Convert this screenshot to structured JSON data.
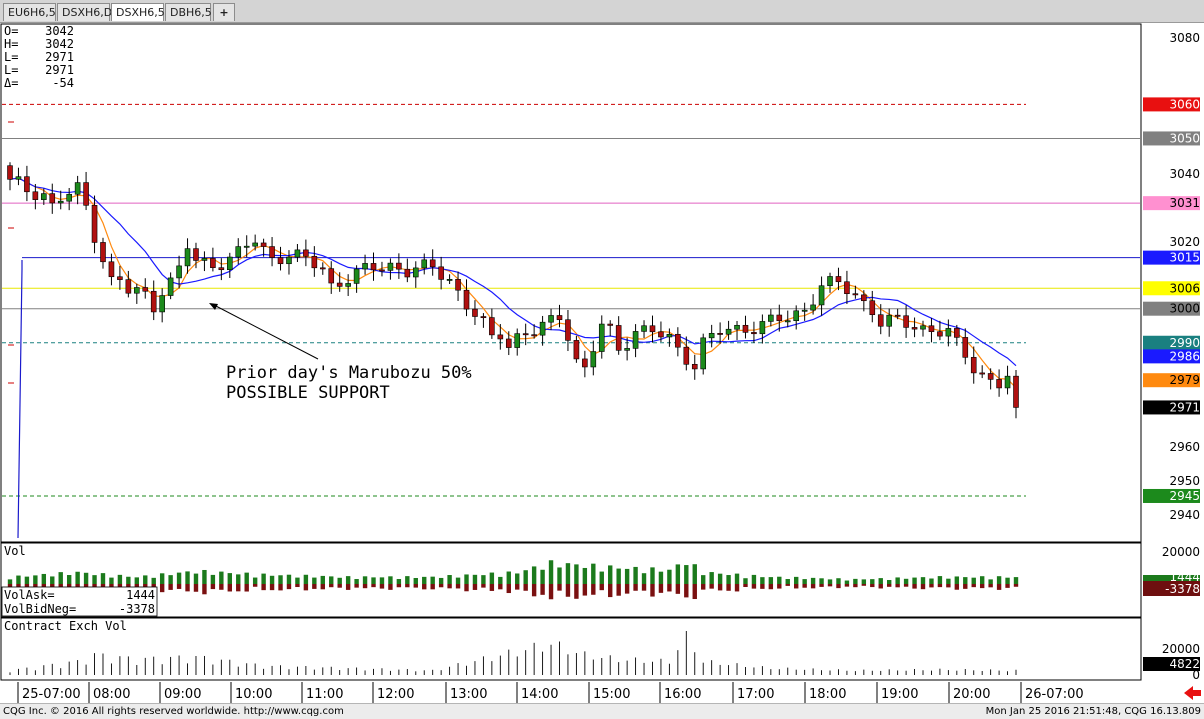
{
  "tabs": [
    {
      "label": "EU6H6,5",
      "active": false
    },
    {
      "label": "DSXH6,D",
      "active": false
    },
    {
      "label": "DSXH6,5",
      "active": true
    },
    {
      "label": "DBH6,5",
      "active": false
    },
    {
      "label": "+",
      "active": false
    }
  ],
  "ohlc_readout": [
    {
      "key": "O=",
      "value": "3042"
    },
    {
      "key": "H=",
      "value": "3042"
    },
    {
      "key": "L=",
      "value": "2971"
    },
    {
      "key": "L=",
      "value": "2971"
    },
    {
      "key": "Δ=",
      "value": "-54"
    }
  ],
  "annotation": {
    "line1": "Prior day's Marubozu 50%",
    "line2": "POSSIBLE SUPPORT"
  },
  "volume_panel": {
    "title": "Vol",
    "readout": [
      {
        "key": "VolAsk=",
        "value": "1444"
      },
      {
        "key": "VolBidNeg=",
        "value": "-3378"
      }
    ],
    "axis_label": "20000",
    "badges": [
      {
        "text": "1444",
        "color": "#1c7a1c"
      },
      {
        "text": "-3378",
        "color": "#6e0f0f"
      }
    ]
  },
  "contract_panel": {
    "title": "Contract Exch Vol",
    "axis_labels": [
      "20000",
      "0"
    ],
    "badge": {
      "text": "4822",
      "color": "#000000"
    }
  },
  "time_axis": {
    "labels": [
      "25-07:00",
      "08:00",
      "09:00",
      "10:00",
      "11:00",
      "12:00",
      "13:00",
      "14:00",
      "15:00",
      "16:00",
      "17:00",
      "18:00",
      "19:00",
      "20:00",
      "26-07:00"
    ]
  },
  "price_axis": {
    "labels": [
      "3080",
      "3040",
      "3020",
      "2960",
      "2950",
      "2940"
    ]
  },
  "price_badges": [
    {
      "text": "3060",
      "color": "#e81010",
      "fg": "#ffffff"
    },
    {
      "text": "3050",
      "color": "#808080",
      "fg": "#ffffff"
    },
    {
      "text": "3031",
      "color": "#ff90d0",
      "fg": "#000000"
    },
    {
      "text": "3015",
      "color": "#1a1aff",
      "fg": "#ffffff"
    },
    {
      "text": "3006",
      "color": "#ffff00",
      "fg": "#000000"
    },
    {
      "text": "3000",
      "color": "#808080",
      "fg": "#000000"
    },
    {
      "text": "2990",
      "color": "#1a8080",
      "fg": "#ffffff"
    },
    {
      "text": "2986",
      "color": "#1a1aff",
      "fg": "#ffffff"
    },
    {
      "text": "2979",
      "color": "#ff8a10",
      "fg": "#000000"
    },
    {
      "text": "2971",
      "color": "#000000",
      "fg": "#ffffff"
    },
    {
      "text": "2945",
      "color": "#1c8a1c",
      "fg": "#ffffff"
    }
  ],
  "footer": {
    "left": "CQG Inc. © 2016 All rights reserved worldwide. http://www.cqg.com",
    "right": "Mon Jan 25 2016 21:51:48, CQG 16.13.809"
  },
  "chart_data": {
    "type": "candlestick",
    "symbol": "DSXH6",
    "interval_minutes": 5,
    "ohlc_summary": {
      "open": 3042,
      "high": 3042,
      "low": 2971,
      "last": 2971,
      "change": -54
    },
    "y_range": [
      2933,
      3085
    ],
    "levels": [
      {
        "value": 3060,
        "color": "#cc0000",
        "style": "dashed"
      },
      {
        "value": 3050,
        "color": "#808080",
        "style": "solid"
      },
      {
        "value": 3031,
        "color": "#e060c0",
        "style": "solid"
      },
      {
        "value": 3015,
        "color": "#1a1acc",
        "style": "solid"
      },
      {
        "value": 3006,
        "color": "#e8e800",
        "style": "solid"
      },
      {
        "value": 3000,
        "color": "#808080",
        "style": "solid"
      },
      {
        "value": 2990,
        "color": "#1a8080",
        "style": "dashed"
      },
      {
        "value": 2945,
        "color": "#1c8a1c",
        "style": "dashed"
      }
    ],
    "moving_averages": [
      {
        "color": "#ff8a10",
        "last": 2979
      },
      {
        "color": "#1a1aff",
        "last": 2986
      }
    ],
    "series_path": [
      [
        0,
        3038
      ],
      [
        2,
        3035
      ],
      [
        4,
        3034
      ],
      [
        5,
        3030
      ],
      [
        6,
        3032
      ],
      [
        8,
        3035
      ],
      [
        9,
        3030
      ],
      [
        10,
        3022
      ],
      [
        11,
        3015
      ],
      [
        12,
        3008
      ],
      [
        13,
        3008
      ],
      [
        14,
        3005
      ],
      [
        15,
        3005
      ],
      [
        16,
        3004
      ],
      [
        17,
        3001
      ],
      [
        18,
        3006
      ],
      [
        19,
        3008
      ],
      [
        20,
        3011
      ],
      [
        21,
        3018
      ],
      [
        22,
        3014
      ],
      [
        24,
        3013
      ],
      [
        27,
        3016
      ],
      [
        29,
        3020
      ],
      [
        31,
        3015
      ],
      [
        33,
        3016
      ],
      [
        35,
        3014
      ],
      [
        37,
        3012
      ],
      [
        38,
        3007
      ],
      [
        39,
        3008
      ],
      [
        41,
        3010
      ],
      [
        43,
        3012
      ],
      [
        45,
        3013
      ],
      [
        47,
        3011
      ],
      [
        50,
        3012
      ],
      [
        52,
        3009
      ],
      [
        53,
        3005
      ],
      [
        54,
        3001
      ],
      [
        56,
        2995
      ],
      [
        57,
        2991
      ],
      [
        58,
        2993
      ],
      [
        59,
        2990
      ],
      [
        60,
        2992
      ],
      [
        62,
        2993
      ],
      [
        64,
        2996
      ],
      [
        65,
        2998
      ],
      [
        66,
        2993
      ],
      [
        67,
        2985
      ],
      [
        68,
        2982
      ],
      [
        69,
        2988
      ],
      [
        70,
        2995
      ],
      [
        71,
        2993
      ],
      [
        72,
        2988
      ],
      [
        74,
        2994
      ],
      [
        76,
        2993
      ],
      [
        78,
        2991
      ],
      [
        79,
        2988
      ],
      [
        80,
        2986
      ],
      [
        81,
        2984
      ],
      [
        82,
        2990
      ],
      [
        84,
        2993
      ],
      [
        86,
        2994
      ],
      [
        88,
        2995
      ],
      [
        90,
        2996
      ],
      [
        92,
        2997
      ],
      [
        94,
        3000
      ],
      [
        96,
        3007
      ],
      [
        98,
        3007
      ],
      [
        100,
        3004
      ],
      [
        102,
        3000
      ],
      [
        103,
        2996
      ],
      [
        105,
        2996
      ],
      [
        107,
        2995
      ],
      [
        109,
        2994
      ],
      [
        111,
        2993
      ],
      [
        112,
        2989
      ],
      [
        113,
        2986
      ],
      [
        114,
        2983
      ],
      [
        115,
        2981
      ],
      [
        116,
        2979
      ],
      [
        117,
        2978
      ],
      [
        118,
        2980
      ],
      [
        119,
        2971
      ]
    ],
    "volume_path": [
      [
        0,
        0.3
      ],
      [
        8,
        0.5
      ],
      [
        15,
        0.3
      ],
      [
        22,
        0.55
      ],
      [
        30,
        0.4
      ],
      [
        40,
        0.3
      ],
      [
        50,
        0.3
      ],
      [
        60,
        0.5
      ],
      [
        64,
        0.9
      ],
      [
        68,
        0.8
      ],
      [
        72,
        0.7
      ],
      [
        78,
        0.6
      ],
      [
        80,
        1.0
      ],
      [
        82,
        0.5
      ],
      [
        90,
        0.3
      ],
      [
        100,
        0.2
      ],
      [
        110,
        0.3
      ],
      [
        119,
        0.3
      ]
    ],
    "contract_path": [
      [
        0,
        0.1
      ],
      [
        8,
        0.3
      ],
      [
        10,
        0.45
      ],
      [
        15,
        0.35
      ],
      [
        22,
        0.4
      ],
      [
        30,
        0.2
      ],
      [
        40,
        0.15
      ],
      [
        50,
        0.1
      ],
      [
        64,
        0.7
      ],
      [
        68,
        0.45
      ],
      [
        72,
        0.35
      ],
      [
        78,
        0.3
      ],
      [
        80,
        0.9
      ],
      [
        82,
        0.3
      ],
      [
        90,
        0.15
      ],
      [
        100,
        0.1
      ],
      [
        110,
        0.12
      ],
      [
        119,
        0.1
      ]
    ]
  }
}
